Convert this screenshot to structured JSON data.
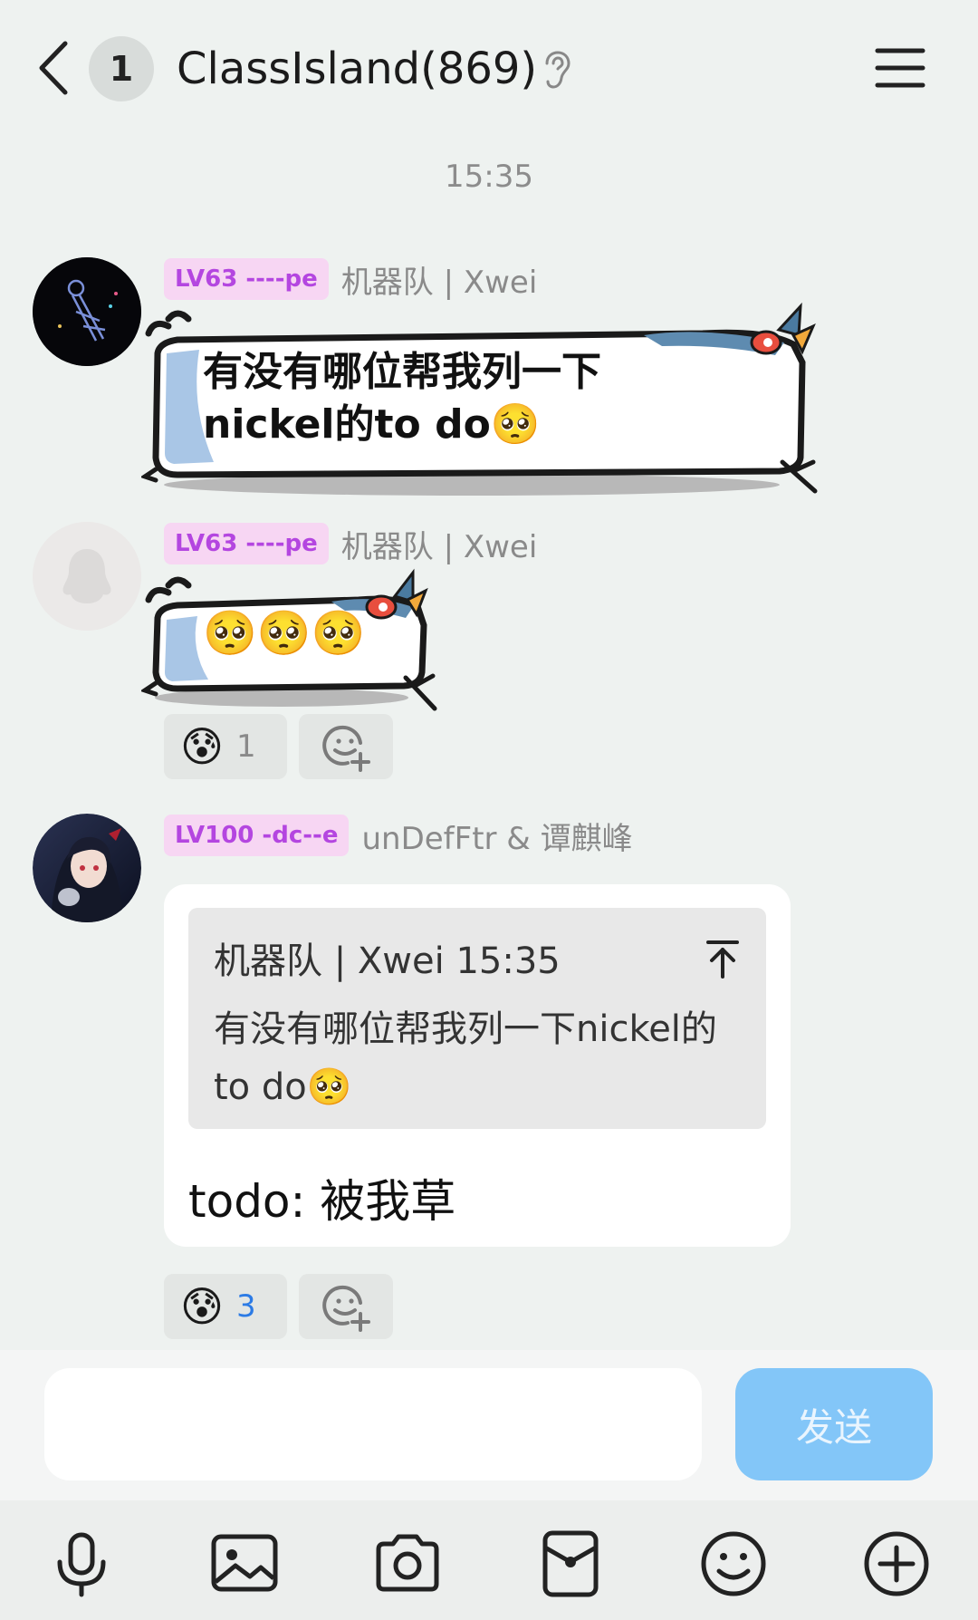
{
  "header": {
    "unread_count": "1",
    "title": "ClassIsland(869)"
  },
  "timestamp": "15:35",
  "messages": [
    {
      "level": "LV63 ----pe",
      "sender": "机器队 | Xwei",
      "line1": "有没有哪位帮我列一下",
      "line2": "nickel的to do🥺"
    },
    {
      "level": "LV63 ----pe",
      "sender": "机器队 | Xwei",
      "text": "🥺🥺🥺",
      "reaction": {
        "emoji": "😰",
        "count": "1"
      }
    },
    {
      "level": "LV100 -dc--e",
      "sender": "unDefFtr & 谭麒峰",
      "quote": {
        "header": "机器队 | Xwei 15:35",
        "text": "有没有哪位帮我列一下nickel的to do🥺"
      },
      "text": "todo: 被我草",
      "reaction": {
        "emoji": "😰",
        "count": "3"
      }
    }
  ],
  "input": {
    "value": "",
    "send_label": "发送"
  },
  "toolbar_icons": [
    "microphone-icon",
    "image-icon",
    "camera-icon",
    "red-packet-icon",
    "emoji-icon",
    "plus-icon"
  ]
}
